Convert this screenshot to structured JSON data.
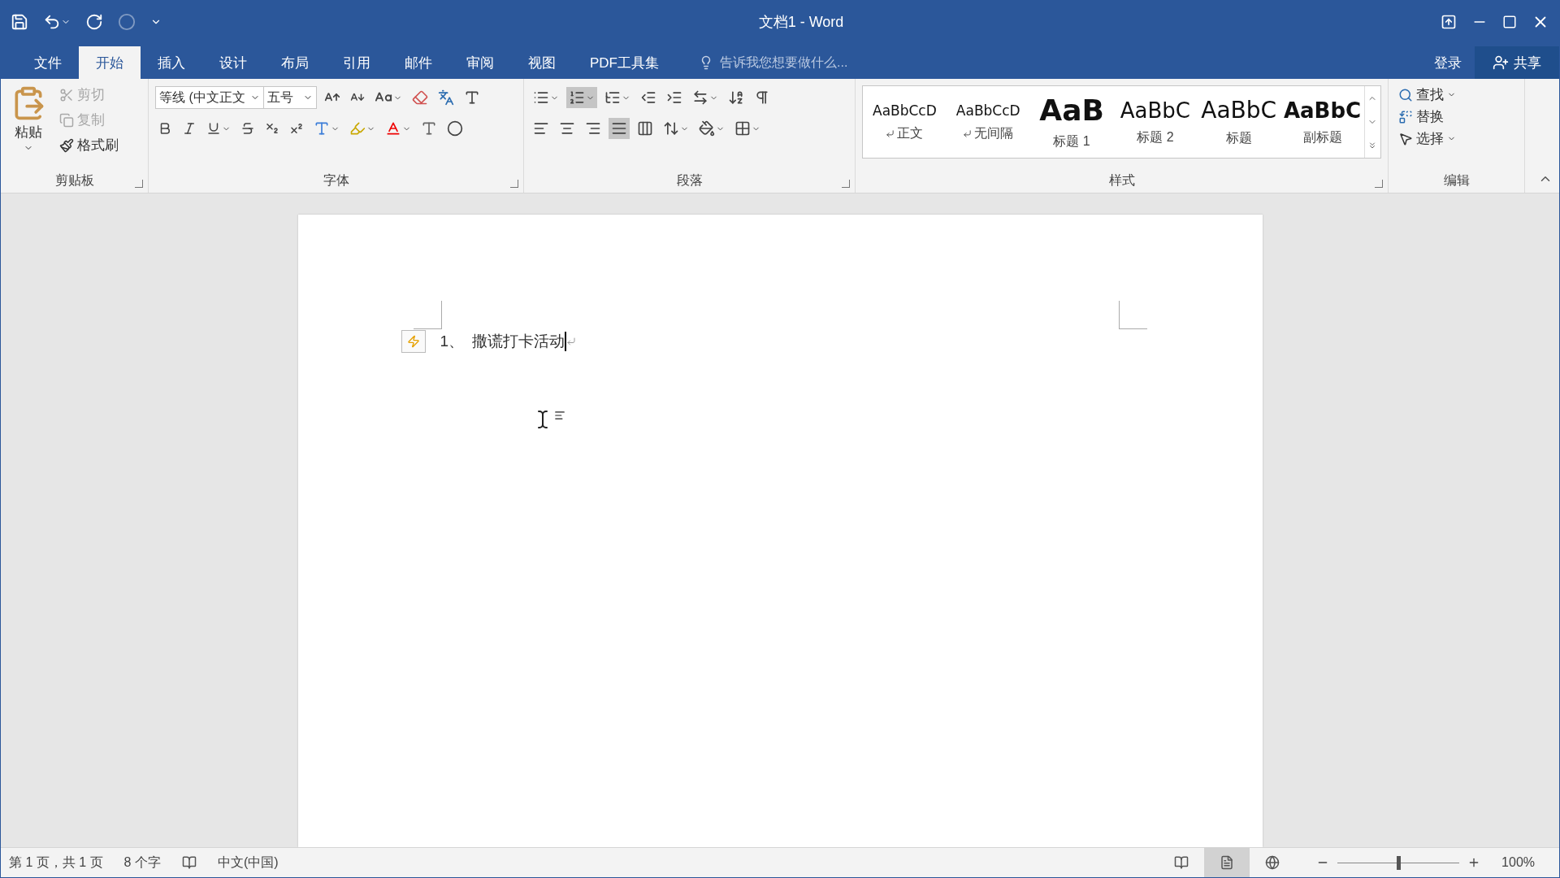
{
  "window": {
    "title": "文档1 - Word"
  },
  "tabs": [
    {
      "label": "文件",
      "selected": false
    },
    {
      "label": "开始",
      "selected": true
    },
    {
      "label": "插入",
      "selected": false
    },
    {
      "label": "设计",
      "selected": false
    },
    {
      "label": "布局",
      "selected": false
    },
    {
      "label": "引用",
      "selected": false
    },
    {
      "label": "邮件",
      "selected": false
    },
    {
      "label": "审阅",
      "selected": false
    },
    {
      "label": "视图",
      "selected": false
    },
    {
      "label": "PDF工具集",
      "selected": false
    }
  ],
  "tell_me": {
    "placeholder": "告诉我您想要做什么..."
  },
  "sign_in": "登录",
  "share": "共享",
  "clipboard": {
    "label": "剪贴板",
    "paste": "粘贴",
    "actions": [
      {
        "kind": "cut",
        "label": "剪切",
        "disabled": true
      },
      {
        "kind": "copy",
        "label": "复制",
        "disabled": true
      },
      {
        "kind": "painter",
        "label": "格式刷",
        "disabled": false
      }
    ]
  },
  "font": {
    "label": "字体",
    "font_name": "等线 (中文正文",
    "font_size": "五号"
  },
  "paragraph": {
    "label": "段落",
    "row_1": [
      {
        "kind": "bullets",
        "selected": false
      },
      {
        "kind": "numbering",
        "selected": true
      },
      {
        "kind": "multilevel",
        "selected": false
      },
      {
        "kind": "outdent",
        "selected": false
      },
      {
        "kind": "indent",
        "selected": false
      },
      {
        "kind": "layout",
        "selected": false
      },
      {
        "kind": "sort",
        "selected": false
      },
      {
        "kind": "marks",
        "selected": false
      }
    ],
    "row_2": [
      {
        "kind": "left",
        "selected": false
      },
      {
        "kind": "center",
        "selected": false
      },
      {
        "kind": "right",
        "selected": false
      },
      {
        "kind": "justify",
        "selected": true
      },
      {
        "kind": "distributed",
        "selected": false
      },
      {
        "kind": "spacing",
        "selected": false
      },
      {
        "kind": "shading",
        "selected": false
      },
      {
        "kind": "borders",
        "selected": false
      }
    ]
  },
  "styles": {
    "label": "样式",
    "items": [
      {
        "preview": "AaBbCcD",
        "name": "正文",
        "kind": "normal"
      },
      {
        "preview": "AaBbCcD",
        "name": "无间隔",
        "kind": "normal"
      },
      {
        "preview": "AaB",
        "name": "标题 1",
        "kind": "heading1"
      },
      {
        "preview": "AaBbC",
        "name": "标题 2",
        "kind": "heading2"
      },
      {
        "preview": "AaBbC",
        "name": "标题",
        "kind": "title"
      },
      {
        "preview": "AaBbC",
        "name": "副标题",
        "kind": "subtitle"
      }
    ]
  },
  "editing": {
    "label": "编辑",
    "find": "查找",
    "replace": "替换",
    "select": "选择"
  },
  "document": {
    "number": "1、",
    "text": "撒谎打卡活动"
  },
  "status_bar": {
    "page": "第 1 页，共 1 页",
    "words": "8 个字",
    "language": "中文(中国)",
    "views": [
      {
        "kind": "read",
        "selected": false
      },
      {
        "kind": "print",
        "selected": true
      },
      {
        "kind": "web",
        "selected": false
      }
    ],
    "zoom": {
      "level": 0.5,
      "reading": "100%"
    }
  }
}
